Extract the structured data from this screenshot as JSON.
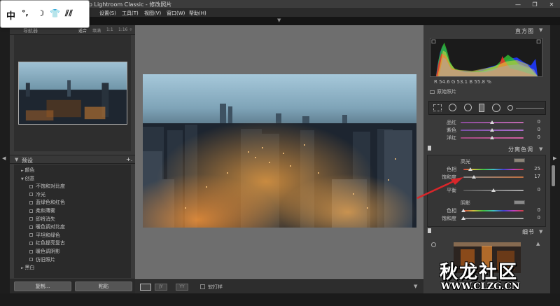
{
  "app_title": "ohop Lightroom Classic - 修改照片",
  "window_buttons": [
    "—",
    "❐",
    "✕"
  ],
  "menu": [
    "设置(S)",
    "工具(T)",
    "视图(V)",
    "窗口(W)",
    "帮助(H)"
  ],
  "ime": {
    "chars": [
      "中",
      "°,",
      "☽",
      "👕",
      "⫽⫽"
    ]
  },
  "navigator": {
    "title": "导航器",
    "fit": "适合",
    "fill": "填满",
    "zoom1": "1:1",
    "zoom2": "1:16 ÷"
  },
  "presets": {
    "title": "预设",
    "add": "+.",
    "items": [
      {
        "label": "颜色",
        "kind": "folder-closed"
      },
      {
        "label": "创意",
        "kind": "folder-open"
      },
      {
        "label": "不饱和对比度",
        "kind": "preset"
      },
      {
        "label": "冷光",
        "kind": "preset"
      },
      {
        "label": "蓝绿色和红色",
        "kind": "preset"
      },
      {
        "label": "柔和薄雾",
        "kind": "preset"
      },
      {
        "label": "即将消失",
        "kind": "preset"
      },
      {
        "label": "暖色调对比度",
        "kind": "preset"
      },
      {
        "label": "平坦和绿色",
        "kind": "preset"
      },
      {
        "label": "红色提亮复古",
        "kind": "preset"
      },
      {
        "label": "暖色调阴影",
        "kind": "preset"
      },
      {
        "label": "仿旧照片",
        "kind": "preset"
      },
      {
        "label": "黑白",
        "kind": "folder-closed"
      }
    ]
  },
  "left_buttons": {
    "copy": "复制...",
    "paste": "粘贴"
  },
  "toolbar": {
    "soft_proof": "软打样"
  },
  "histogram": {
    "title": "直方图",
    "readout": "R  54.6  G  53.1  B  55.8  %",
    "original_photo": "原始照片"
  },
  "hsl_rows": [
    {
      "label": "品红",
      "value": "0"
    },
    {
      "label": "紫色",
      "value": "0"
    },
    {
      "label": "洋红",
      "value": "0"
    }
  ],
  "split_toning": {
    "title": "分离色调",
    "highlights": "高光",
    "hl_hue_label": "色相",
    "hl_hue_value": "25",
    "hl_sat_label": "饱和度",
    "hl_sat_value": "17",
    "balance_label": "平衡",
    "balance_value": "0",
    "shadows": "阴影",
    "sh_hue_label": "色相",
    "sh_hue_value": "0",
    "sh_sat_label": "饱和度",
    "sh_sat_value": "0"
  },
  "detail": {
    "title": "细节"
  },
  "watermark": {
    "text": "秋龙社区",
    "url": "WWW.CLZG.CN"
  },
  "colors": {
    "accent_red": "#d9262a",
    "panel": "#3a3a3a",
    "center_bg": "#6e6e6e"
  }
}
